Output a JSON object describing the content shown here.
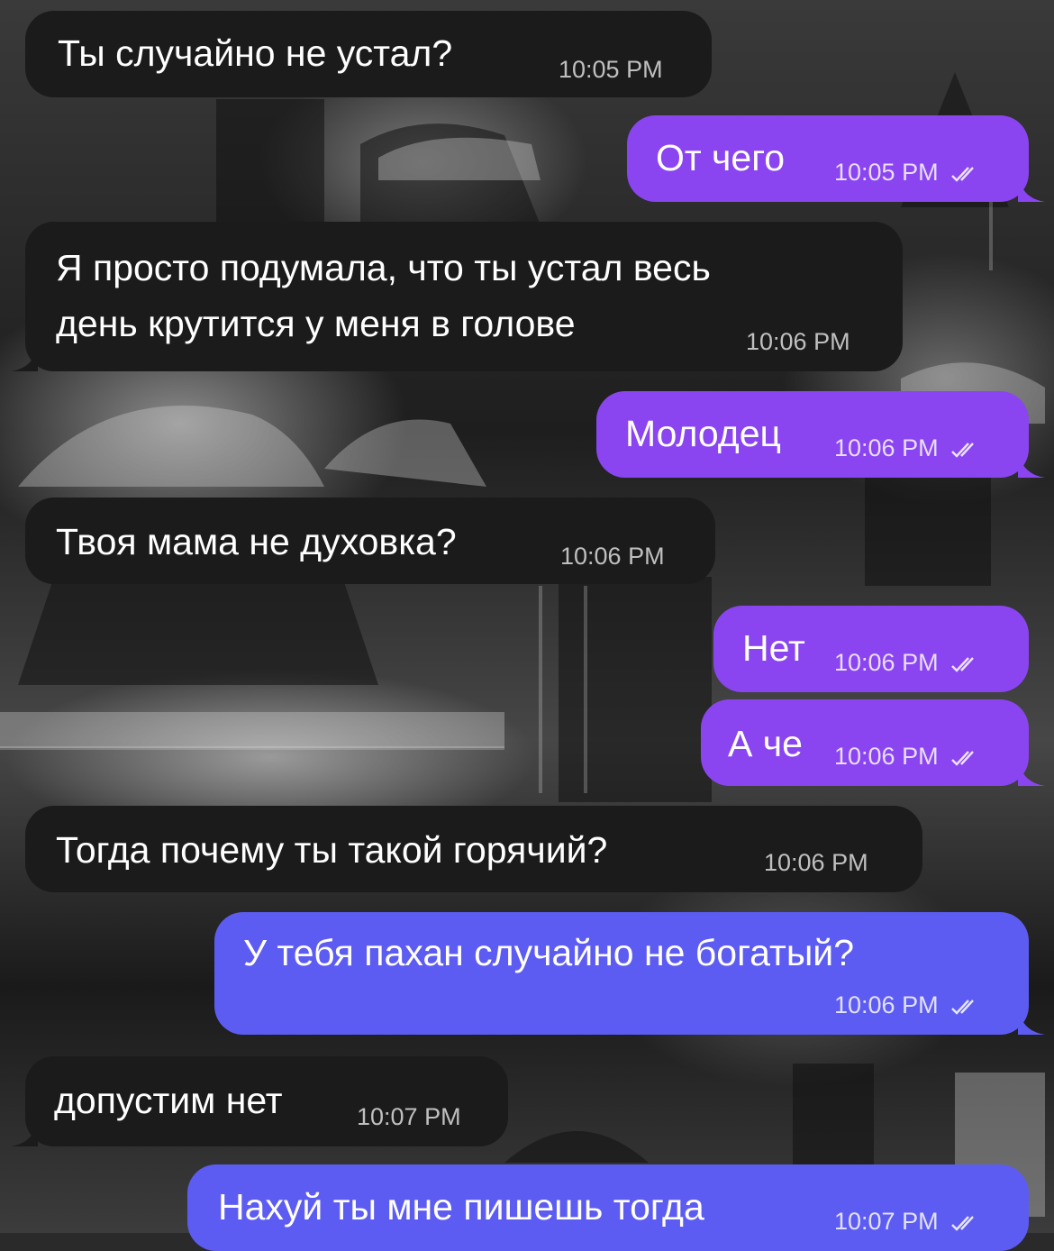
{
  "messages": [
    {
      "text": "Ты случайно не устал?",
      "time": "10:05 PM",
      "dir": "in"
    },
    {
      "text": "От чего",
      "time": "10:05 PM",
      "dir": "out",
      "status": "read"
    },
    {
      "text_lines": [
        "Я просто подумала, что ты устал весь",
        "день крутится у меня в голове"
      ],
      "time": "10:06 PM",
      "dir": "in"
    },
    {
      "text": "Молодец",
      "time": "10:06 PM",
      "dir": "out",
      "status": "read"
    },
    {
      "text": "Твоя мама не духовка?",
      "time": "10:06 PM",
      "dir": "in"
    },
    {
      "text": "Нет",
      "time": "10:06 PM",
      "dir": "out",
      "status": "read"
    },
    {
      "text": "А че",
      "time": "10:06 PM",
      "dir": "out",
      "status": "read"
    },
    {
      "text": "Тогда почему ты такой горячий?",
      "time": "10:06 PM",
      "dir": "in"
    },
    {
      "text": "У тебя пахан случайно не богатый?",
      "time": "10:06 PM",
      "dir": "out",
      "status": "read"
    },
    {
      "text": "допустим нет",
      "time": "10:07 PM",
      "dir": "in"
    },
    {
      "text": "Нахуй ты мне пишешь тогда",
      "time": "10:07 PM",
      "dir": "out",
      "status": "read"
    }
  ],
  "colors": {
    "incoming_bubble": "#1b1b1b",
    "outgoing_bubble": "#8a45f0",
    "outgoing_bubble_late": "#5d5cf2"
  },
  "icons": {
    "read_status": "double-check-icon",
    "background": "cathedral-photo"
  }
}
